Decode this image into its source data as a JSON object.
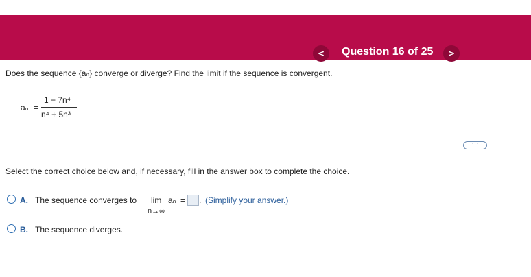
{
  "header": {
    "prev_label": "<",
    "next_label": ">",
    "title": "Question 16 of 25"
  },
  "question": {
    "prompt": "Does the sequence {aₙ} converge or diverge? Find the limit if the sequence is convergent.",
    "formula": {
      "lhs": "aₙ",
      "equals": "=",
      "numerator": "1 − 7n⁴",
      "denominator": "n⁴ + 5n³"
    }
  },
  "divider": {
    "label": "⋯"
  },
  "instruction": "Select the correct choice below and, if necessary, fill in the answer box to complete the choice.",
  "choices": [
    {
      "letter": "A.",
      "text": "The sequence converges to",
      "lim": "lim",
      "sequence_term": "aₙ",
      "equals": "=",
      "subscript": "n→∞",
      "answer_value": "",
      "period": ".",
      "hint": "(Simplify your answer.)"
    },
    {
      "letter": "B.",
      "text": "The sequence diverges."
    }
  ],
  "colors": {
    "banner": "#b80c4a",
    "choice_accent": "#2a5d9a"
  }
}
